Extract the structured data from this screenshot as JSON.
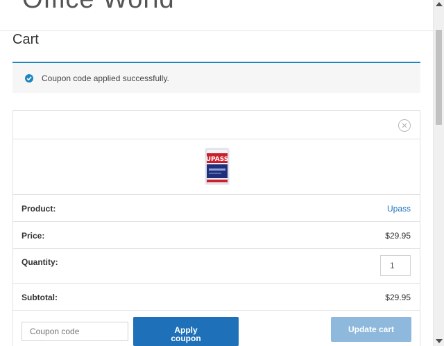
{
  "site": {
    "title": "Office World"
  },
  "page": {
    "title": "Cart"
  },
  "notice": {
    "message": "Coupon code applied successfully.",
    "icon": "check-circle-icon",
    "accent": "#1e85be"
  },
  "cart": {
    "remove_icon": "close-circle-icon",
    "product_image": "upass-product-thumbnail",
    "rows": {
      "product": {
        "label": "Product:",
        "value": "Upass"
      },
      "price": {
        "label": "Price:",
        "value": "$29.95"
      },
      "quantity": {
        "label": "Quantity:",
        "value": "1"
      },
      "subtotal": {
        "label": "Subtotal:",
        "value": "$29.95"
      }
    }
  },
  "actions": {
    "coupon_placeholder": "Coupon code",
    "apply_label_line1": "Apply",
    "apply_label_line2": "coupon",
    "update_label": "Update cart",
    "primary_color": "#1e70b8",
    "disabled_color": "#8fb9dc"
  }
}
